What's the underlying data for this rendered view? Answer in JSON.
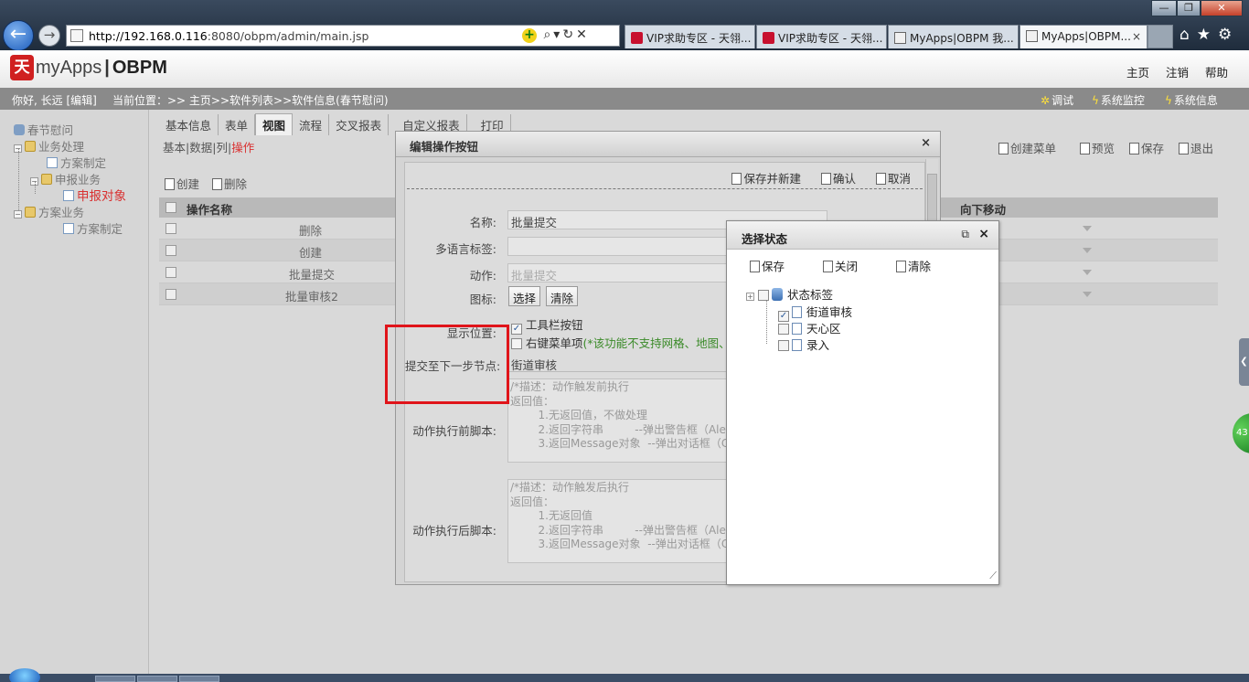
{
  "browser": {
    "url_host": "http://192.168.0.116",
    "url_rest": ":8080/obpm/admin/main.jsp",
    "tabs": [
      {
        "label": "VIP求助专区 - 天翎...",
        "icon": "red-logo-icon"
      },
      {
        "label": "VIP求助专区 - 天翎...",
        "icon": "red-logo-icon"
      },
      {
        "label": "MyApps|OBPM 我...",
        "icon": "page-icon"
      },
      {
        "label": "MyApps|OBPM...",
        "icon": "page-icon",
        "active": true
      }
    ],
    "tab_close": "×",
    "tool_icons": [
      "home-icon",
      "star-icon",
      "gear-icon"
    ]
  },
  "app": {
    "logo_mark": "天",
    "logo_name": "myApps",
    "logo_product": "OBPM",
    "top_links": [
      "主页",
      "注销",
      "帮助"
    ]
  },
  "infobar": {
    "greeting": "你好, 长远 [编辑]",
    "location": "当前位置：>> 主页>>软件列表>>软件信息(春节慰问)",
    "tools": [
      "调试",
      "系统监控",
      "系统信息"
    ]
  },
  "tree": {
    "root": "春节慰问",
    "items": [
      {
        "label": "业务处理",
        "level": 1,
        "type": "folder"
      },
      {
        "label": "方案制定",
        "level": 2,
        "type": "doc"
      },
      {
        "label": "申报业务",
        "level": 2,
        "type": "folder"
      },
      {
        "label": "申报对象",
        "level": 3,
        "type": "doc",
        "selected": true
      },
      {
        "label": "方案业务",
        "level": 1,
        "type": "folder"
      },
      {
        "label": "方案制定",
        "level": 2,
        "type": "doc"
      }
    ]
  },
  "main": {
    "tabs": [
      "基本信息",
      "表单",
      "视图",
      "流程",
      "交叉报表",
      "自定义报表",
      "打印"
    ],
    "active_tab": "视图",
    "subtabs": [
      "基本",
      "数据",
      "列",
      "操作"
    ],
    "subtab_separator": "|",
    "active_subtab": "操作",
    "top_actions": [
      "创建菜单",
      "预览",
      "保存",
      "退出"
    ],
    "list_actions": [
      "创建",
      "删除"
    ],
    "table": {
      "headers": [
        "操作名称",
        "向下移动"
      ],
      "rows": [
        "删除",
        "创建",
        "批量提交",
        "批量审核2"
      ]
    }
  },
  "edit_dialog": {
    "title": "编辑操作按钮",
    "close": "×",
    "toolbar": [
      "保存并新建",
      "确认",
      "取消"
    ],
    "fields": {
      "name_label": "名称:",
      "name_value": "批量提交",
      "i18n_label": "多语言标签:",
      "i18n_value": "",
      "action_label": "动作:",
      "action_value": "批量提交",
      "icon_label": "图标:",
      "icon_buttons": [
        "选择",
        "清除"
      ],
      "display_label": "显示位置:",
      "display_toolbar": "工具栏按钮",
      "display_toolbar_checked": true,
      "display_menu": "右键菜单项",
      "display_menu_note": "(*该功能不支持网格、地图、日",
      "next_node_label": "提交至下一步节点:",
      "next_node_value": "街道审核",
      "before_label": "动作执行前脚本:",
      "before_script": "/*描述：动作触发前执行\n返回值：\n        1.无返回值，不做处理\n        2.返回字符串         --弹出警告框（Aler\n        3.返回Message对象  --弹出对话框（Co",
      "after_label": "动作执行后脚本:",
      "after_script": "/*描述：动作触发后执行\n返回值：\n        1.无返回值\n        2.返回字符串         --弹出警告框（Aler\n        3.返回Message对象  --弹出对话框（Co"
    }
  },
  "state_dialog": {
    "title": "选择状态",
    "popout_icon": "popout-icon",
    "close": "×",
    "toolbar": [
      "保存",
      "关闭",
      "清除"
    ],
    "root": "状态标签",
    "items": [
      {
        "label": "街道审核",
        "checked": true
      },
      {
        "label": "天心区",
        "checked": false
      },
      {
        "label": "录入",
        "checked": false
      }
    ],
    "resize_glyph": "⟋"
  },
  "side_widgets": {
    "handle_glyph": "❮",
    "bubble_text": "43"
  },
  "colors": {
    "highlight_box": "#e0141a",
    "selected_tree": "#d93030",
    "note_green": "#3a8a28"
  }
}
